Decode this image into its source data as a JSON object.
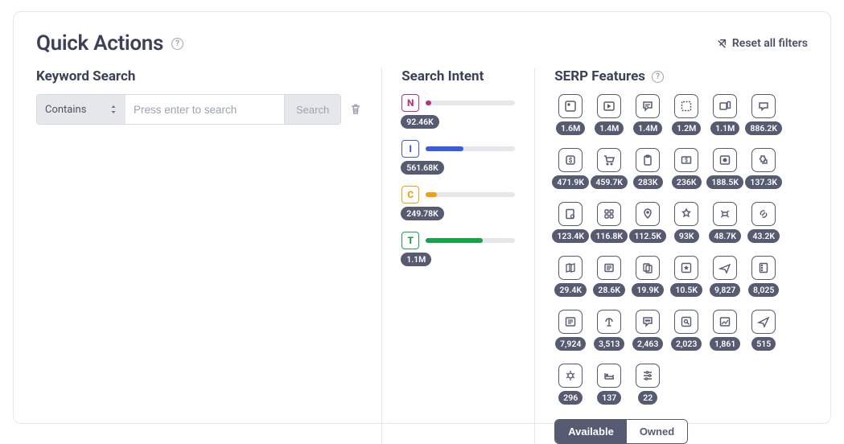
{
  "header": {
    "title": "Quick Actions",
    "reset_label": "Reset all filters"
  },
  "keyword_search": {
    "heading": "Keyword Search",
    "mode_label": "Contains",
    "placeholder": "Press enter to search",
    "search_label": "Search"
  },
  "search_intent": {
    "heading": "Search Intent",
    "items": [
      {
        "letter": "N",
        "count": "92.46K",
        "color": "#b83280",
        "border": "#b83280",
        "pct": 6
      },
      {
        "letter": "I",
        "count": "561.68K",
        "color": "#3b5bdb",
        "border": "#3b5bdb",
        "pct": 42
      },
      {
        "letter": "C",
        "count": "249.78K",
        "color": "#f59e0b",
        "border": "#f59e0b",
        "pct": 12
      },
      {
        "letter": "T",
        "count": "1.1M",
        "color": "#16a34a",
        "border": "#16a34a",
        "pct": 64
      }
    ]
  },
  "serp_features": {
    "heading": "SERP Features",
    "items": [
      {
        "icon": "image-pack",
        "count": "1.6M"
      },
      {
        "icon": "video",
        "count": "1.4M"
      },
      {
        "icon": "reviews",
        "count": "1.4M"
      },
      {
        "icon": "sitelinks",
        "count": "1.2M"
      },
      {
        "icon": "carousel",
        "count": "1.1M"
      },
      {
        "icon": "discussion",
        "count": "886.2K"
      },
      {
        "icon": "price",
        "count": "471.9K"
      },
      {
        "icon": "shopping",
        "count": "459.7K"
      },
      {
        "icon": "clipboard",
        "count": "283K"
      },
      {
        "icon": "paid",
        "count": "236K"
      },
      {
        "icon": "featured-video",
        "count": "188.5K"
      },
      {
        "icon": "addon",
        "count": "137.3K"
      },
      {
        "icon": "knowledge-panel",
        "count": "123.4K"
      },
      {
        "icon": "apps",
        "count": "116.8K"
      },
      {
        "icon": "local-pack",
        "count": "112.5K"
      },
      {
        "icon": "popular",
        "count": "93K"
      },
      {
        "icon": "drone",
        "count": "48.7K"
      },
      {
        "icon": "link",
        "count": "43.2K"
      },
      {
        "icon": "map",
        "count": "29.4K"
      },
      {
        "icon": "recipe",
        "count": "28.6K"
      },
      {
        "icon": "copy",
        "count": "19.9K"
      },
      {
        "icon": "star",
        "count": "10.5K"
      },
      {
        "icon": "flights",
        "count": "9,827"
      },
      {
        "icon": "address",
        "count": "8,025"
      },
      {
        "icon": "news",
        "count": "7,924"
      },
      {
        "icon": "podcast",
        "count": "3,513"
      },
      {
        "icon": "faq",
        "count": "2,463"
      },
      {
        "icon": "search-page",
        "count": "2,023"
      },
      {
        "icon": "image",
        "count": "1,861"
      },
      {
        "icon": "ads",
        "count": "515"
      },
      {
        "icon": "bug",
        "count": "296"
      },
      {
        "icon": "hotel",
        "count": "137"
      },
      {
        "icon": "filter",
        "count": "22"
      }
    ],
    "toggle": {
      "available": "Available",
      "owned": "Owned"
    }
  }
}
